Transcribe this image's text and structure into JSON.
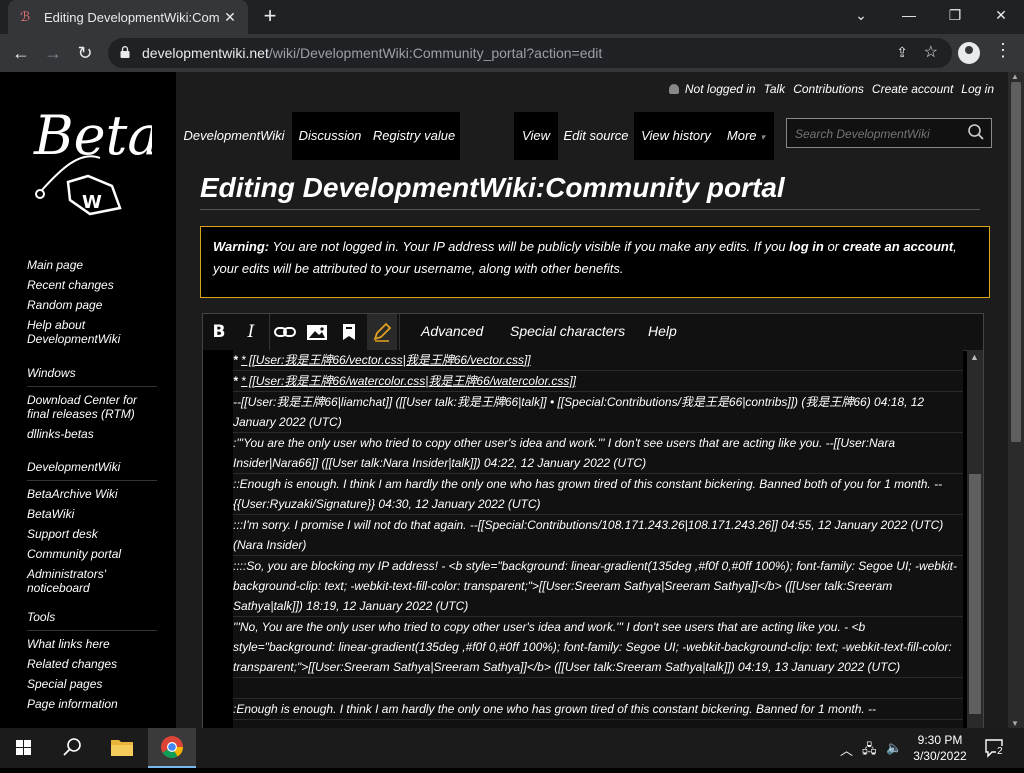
{
  "browser": {
    "tab_title": "Editing DevelopmentWiki:Commu",
    "url_host": "developmentwiki.net",
    "url_path": "/wiki/DevelopmentWiki:Community_portal?action=edit"
  },
  "site": {
    "logo_text": "Beta",
    "personal_tools": {
      "not_logged_in": "Not logged in",
      "talk": "Talk",
      "contributions": "Contributions",
      "create_account": "Create account",
      "log_in": "Log in"
    },
    "namespace_tabs": [
      "DevelopmentWiki",
      "Discussion",
      "Registry value"
    ],
    "view_tabs": [
      "View",
      "Edit source",
      "View history",
      "More"
    ],
    "search_placeholder": "Search DevelopmentWiki"
  },
  "sidebar": {
    "navigation": [
      "Main page",
      "Recent changes",
      "Random page",
      "Help about DevelopmentWiki"
    ],
    "windows": {
      "heading": "Windows",
      "items": [
        "Download Center for final releases (RTM)",
        "dllinks-betas"
      ]
    },
    "developmentwiki": {
      "heading": "DevelopmentWiki",
      "items": [
        "BetaArchive Wiki",
        "BetaWiki",
        "Support desk",
        "Community portal",
        "Administrators' noticeboard"
      ]
    },
    "tools": {
      "heading": "Tools",
      "items": [
        "What links here",
        "Related changes",
        "Special pages",
        "Page information"
      ]
    }
  },
  "page": {
    "title": "Editing DevelopmentWiki:Community portal",
    "warning": {
      "label": "Warning:",
      "text1": " You are not logged in. Your IP address will be publicly visible if you make any edits. If you ",
      "login": "log in",
      "text2": " or ",
      "create": "create an account",
      "text3": ", your edits will be attributed to your username, along with other benefits."
    }
  },
  "editor": {
    "toolbar": {
      "bold": "B",
      "italic": "I",
      "advanced": "Advanced",
      "special_characters": "Special characters",
      "help": "Help"
    },
    "lines": [
      "* [[User:我是王牌66/vector.css|我是王牌66/vector.css]]",
      "* [[User:我是王牌66/watercolor.css|我是王牌66/watercolor.css]]",
      "--[[User:我是王牌66|liamchat]] ([[User talk:我是王牌66|talk]] • [[Special:Contributions/我是王是66|contribs]]) (我是王牌66) 04:18, 12 January 2022 (UTC)",
      ":'''You are the only user who tried to copy other user's idea and work.''' I don't see users that are acting like you. --[[User:Nara Insider|Nara66]] ([[User talk:Nara Insider|talk]]) 04:22, 12 January 2022 (UTC)",
      "::Enough is enough. I think I am hardly the only one who has grown tired of this constant bickering. Banned both of you for 1 month. --{{User:Ryuzaki/Signature}} 04:30, 12 January 2022 (UTC)",
      ":::I'm sorry. I promise I will not do that again. --[[Special:Contributions/108.171.243.26|108.171.243.26]] 04:55, 12 January 2022 (UTC) (Nara Insider)",
      "::::So, you are blocking my IP address! - <b style=\"background: linear-gradient(135deg ,#f0f 0,#0ff 100%); font-family: Segoe UI; -webkit-background-clip: text; -webkit-text-fill-color: transparent;\">[[User:Sreeram Sathya|Sreeram Sathya]]</b> ([[User talk:Sreeram Sathya|talk]]) 18:19, 12 January 2022 (UTC)",
      "'''No, You are the only user who tried to copy other user's idea and work.'''  I don't see users that are acting like you. - <b style=\"background: linear-gradient(135deg ,#f0f 0,#0ff 100%); font-family: Segoe UI; -webkit-background-clip: text; -webkit-text-fill-color: transparent;\">[[User:Sreeram Sathya|Sreeram Sathya]]</b> ([[User talk:Sreeram Sathya|talk]]) 04:19, 13 January 2022 (UTC)",
      "",
      ":Enough is enough. I think I am hardly the only one who has grown tired of this constant bickering. Banned for 1 month. --"
    ]
  },
  "taskbar": {
    "time": "9:30 PM",
    "date": "3/30/2022",
    "notifications": "2"
  }
}
